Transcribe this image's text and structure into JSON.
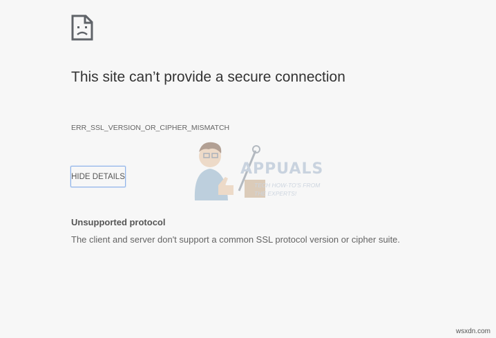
{
  "error_page": {
    "icon": "sad-document-icon",
    "title": "This site can’t provide a secure connection",
    "error_code": "ERR_SSL_VERSION_OR_CIPHER_MISMATCH",
    "details_button_label": "HIDE DETAILS",
    "details": {
      "heading": "Unsupported protocol",
      "text": "The client and server don't support a common SSL protocol version or cipher suite."
    }
  },
  "watermark": {
    "brand": "APPUALS",
    "tagline_line1": "TECH HOW-TO'S FROM",
    "tagline_line2": "THE EXPERTS!"
  },
  "site_credit": "wsxdn.com",
  "colors": {
    "background": "#f7f7f7",
    "title": "#333333",
    "body_text": "#646464",
    "button_border": "#8fb3e8"
  }
}
